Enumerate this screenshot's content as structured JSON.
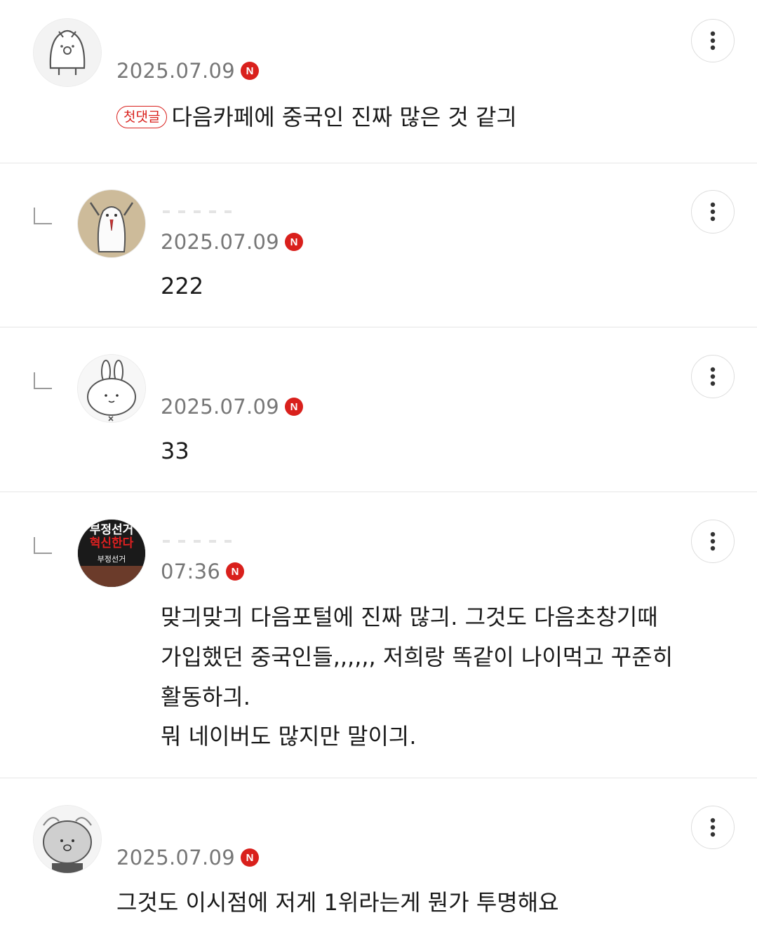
{
  "comments": [
    {
      "date": "2025.07.09",
      "badge": "N",
      "first_label": "첫댓글",
      "text": "다음카페에 중국인 진짜 많은 것 같긔",
      "avatar": "penguin-icon"
    },
    {
      "date": "2025.07.09",
      "badge": "N",
      "text": "222",
      "avatar": "hamster-icon"
    },
    {
      "date": "2025.07.09",
      "badge": "N",
      "text": "33",
      "avatar": "rabbit-icon"
    },
    {
      "date": "07:36",
      "badge": "N",
      "text_lines": [
        "맞긔맞긔 다음포털에 진짜 많긔. 그것도 다음초창기때",
        "가입했던 중국인들,,,,,, 저희랑 똑같이 나이먹고 꾸준히",
        "활동하긔.",
        "뭐 네이버도 많지만 말이긔."
      ],
      "avatar": "book-cover-image",
      "avatar_text": [
        "부정선거",
        "혁신한다",
        "부정선거"
      ]
    },
    {
      "date": "2025.07.09",
      "badge": "N",
      "text": "그것도 이시점에 저게 1위라는게 뭔가 투명해요",
      "avatar": "cat-icon"
    }
  ],
  "colors": {
    "badge_red": "#d9201c",
    "date_gray": "#777777",
    "divider": "#e6e6e6"
  }
}
